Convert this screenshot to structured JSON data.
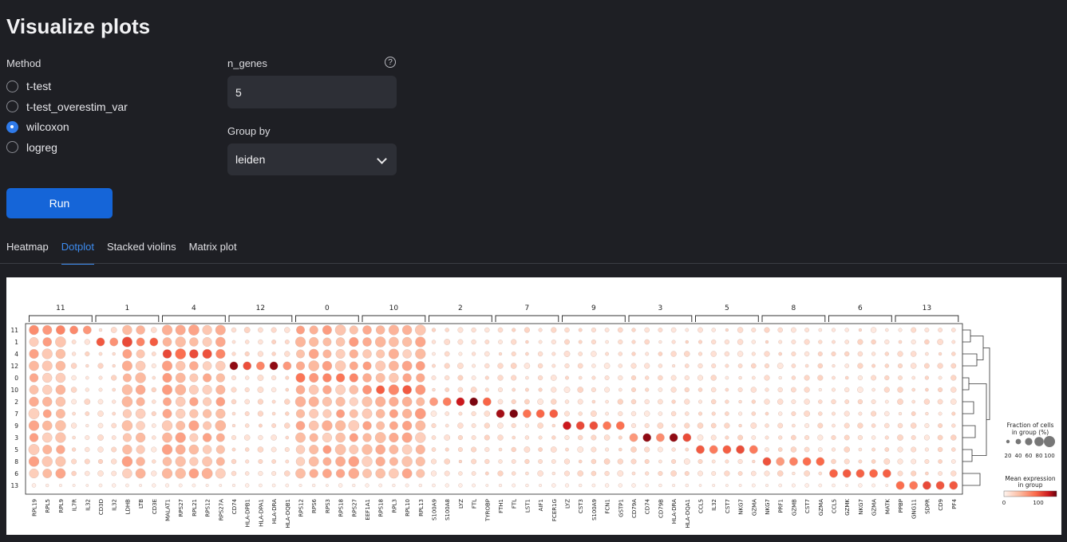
{
  "title": "Visualize plots",
  "method": {
    "label": "Method",
    "options": [
      "t-test",
      "t-test_overestim_var",
      "wilcoxon",
      "logreg"
    ],
    "selected": "wilcoxon"
  },
  "n_genes": {
    "label": "n_genes",
    "value": "5",
    "help": "?"
  },
  "group_by": {
    "label": "Group by",
    "value": "leiden"
  },
  "run_label": "Run",
  "tabs": [
    "Heatmap",
    "Dotplot",
    "Stacked violins",
    "Matrix plot"
  ],
  "active_tab": "Dotplot",
  "colors": {
    "accent": "#1565d8",
    "active_tab": "#3d8cf0",
    "dot_high": "#67000d",
    "dot_low": "#fff5f0"
  },
  "chart_data": {
    "type": "scatter",
    "subtype": "dotplot",
    "group_order": [
      "11",
      "1",
      "4",
      "12",
      "0",
      "10",
      "2",
      "7",
      "9",
      "3",
      "5",
      "8",
      "6",
      "13"
    ],
    "gene_groups": [
      {
        "name": "11",
        "genes": [
          "RPL19",
          "RPL5",
          "RPL9",
          "IL7R",
          "IL32"
        ]
      },
      {
        "name": "1",
        "genes": [
          "CD3D",
          "IL32",
          "LDHB",
          "LTB",
          "CD3E"
        ]
      },
      {
        "name": "4",
        "genes": [
          "MALAT1",
          "RPS27",
          "RPL21",
          "RPS12",
          "RPS27A"
        ]
      },
      {
        "name": "12",
        "genes": [
          "CD74",
          "HLA-DPB1",
          "HLA-DPA1",
          "HLA-DRA",
          "HLA-DQB1"
        ]
      },
      {
        "name": "0",
        "genes": [
          "RPS12",
          "RPS6",
          "RPS3",
          "RPS18",
          "RPS27"
        ]
      },
      {
        "name": "10",
        "genes": [
          "EEF1A1",
          "RPS18",
          "RPL3",
          "RPL10",
          "RPL13"
        ]
      },
      {
        "name": "2",
        "genes": [
          "S100A9",
          "S100A8",
          "LYZ",
          "FTL",
          "TYROBP"
        ]
      },
      {
        "name": "7",
        "genes": [
          "FTH1",
          "FTL",
          "LST1",
          "AIF1",
          "FCER1G"
        ]
      },
      {
        "name": "9",
        "genes": [
          "LYZ",
          "CST3",
          "S100A9",
          "FCN1",
          "GSTP1"
        ]
      },
      {
        "name": "3",
        "genes": [
          "CD79A",
          "CD74",
          "CD79B",
          "HLA-DRA",
          "HLA-DQA1"
        ]
      },
      {
        "name": "5",
        "genes": [
          "CCL5",
          "IL32",
          "CST7",
          "NKG7",
          "GZMA"
        ]
      },
      {
        "name": "8",
        "genes": [
          "NKG7",
          "PRF1",
          "GZMB",
          "CST7",
          "GZMA"
        ]
      },
      {
        "name": "6",
        "genes": [
          "CCL5",
          "GZMK",
          "NKG7",
          "GZMA",
          "MATK"
        ]
      },
      {
        "name": "13",
        "genes": [
          "PPBP",
          "GNG11",
          "SDPR",
          "CD9",
          "PF4"
        ]
      }
    ],
    "legend_size": {
      "title": "Fraction of cells\nin group (%)",
      "ticks": [
        20,
        40,
        60,
        80,
        100
      ]
    },
    "legend_color": {
      "title": "Mean expression\nin group",
      "ticks": [
        0,
        100
      ]
    },
    "dendrogram": true
  }
}
